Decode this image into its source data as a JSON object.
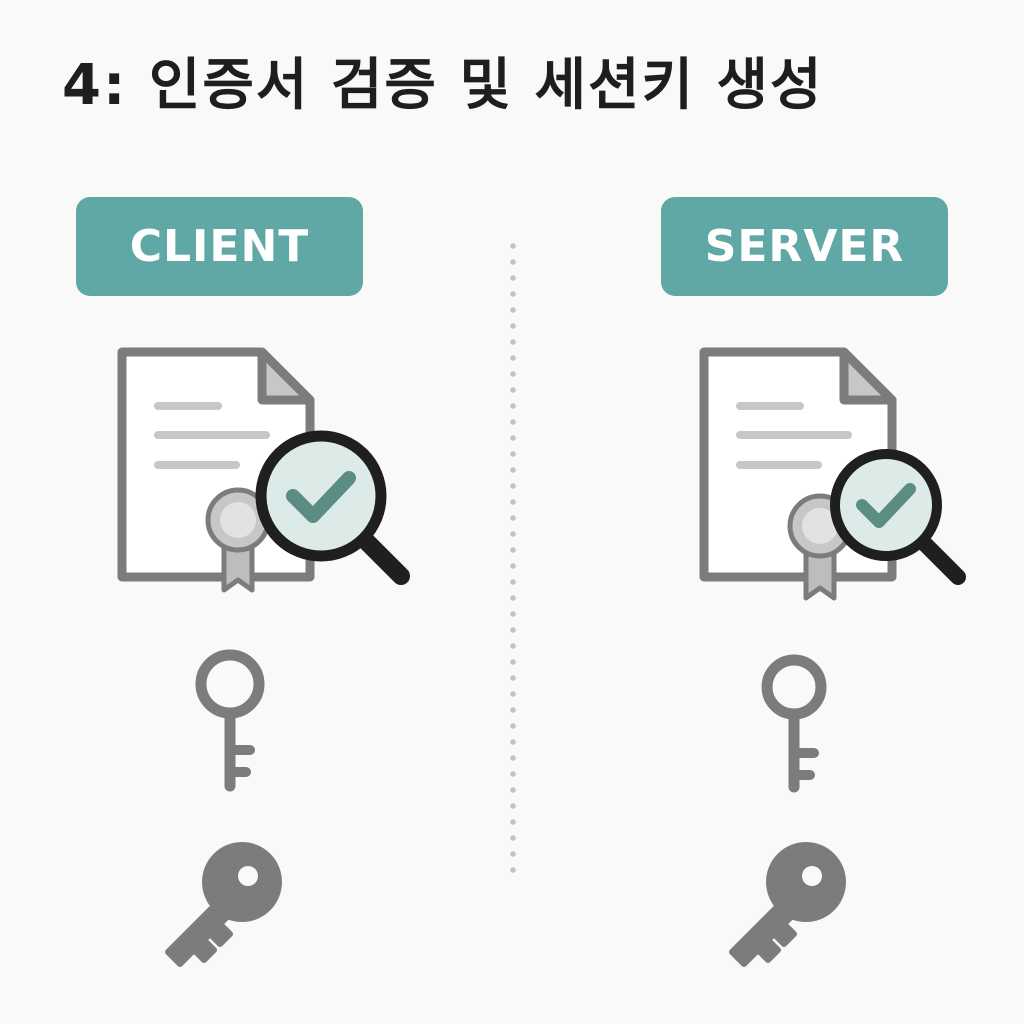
{
  "title": "4: 인증서 검증 및 세션키 생성",
  "colors": {
    "accent": "#5fa8a6",
    "icon_gray": "#7c7c7c",
    "icon_light": "#c7c7c7",
    "check": "#5b8d85",
    "lens_fill": "#dcebe7",
    "lens_ring": "#1f1f1f"
  },
  "columns": [
    {
      "label": "CLIENT",
      "icons": [
        "certificate-icon",
        "magnifier-check-icon",
        "key-outline-icon",
        "key-filled-icon"
      ]
    },
    {
      "label": "SERVER",
      "icons": [
        "certificate-icon",
        "magnifier-check-icon",
        "key-outline-icon",
        "key-filled-icon"
      ]
    }
  ]
}
